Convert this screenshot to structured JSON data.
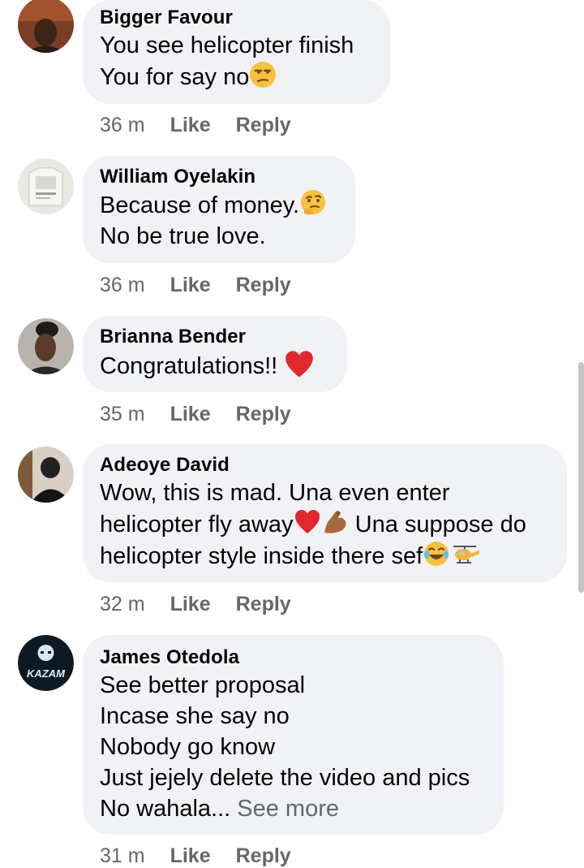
{
  "comments": [
    {
      "author": "Bigger Favour",
      "lines": [
        "You see helicopter finish",
        "You for say no"
      ],
      "time": "36 m",
      "like": "Like",
      "reply": "Reply",
      "emoji": [
        "unamused-face"
      ]
    },
    {
      "author": "William Oyelakin",
      "lines": [
        "Because of money.",
        "No be true love."
      ],
      "time": "36 m",
      "like": "Like",
      "reply": "Reply",
      "emoji": [
        "thinking-face"
      ]
    },
    {
      "author": "Brianna Bender",
      "lines": [
        "Congratulations!! "
      ],
      "time": "35 m",
      "like": "Like",
      "reply": "Reply",
      "emoji": [
        "red-heart"
      ]
    },
    {
      "author": "Adeoye David",
      "lines": [
        "Wow, this is mad. Una even enter",
        "helicopter fly away",
        " Una suppose do",
        "helicopter style inside there sef"
      ],
      "time": "32 m",
      "like": "Like",
      "reply": "Reply",
      "emoji": [
        "red-heart",
        "flexed-biceps",
        "tears-of-joy",
        "helicopter"
      ]
    },
    {
      "author": "James Otedola",
      "lines": [
        "See better proposal",
        "Incase she say no",
        "Nobody go know",
        "Just jejely delete the video and pics",
        "No wahala... "
      ],
      "see_more": "See more",
      "time": "31 m",
      "like": "Like",
      "reply": "Reply",
      "avatar_text": "KAZAM"
    }
  ],
  "colors": {
    "bubble": "#f0f2f5",
    "text": "#050505",
    "secondary": "#65676b",
    "heart": "#e0282e"
  }
}
